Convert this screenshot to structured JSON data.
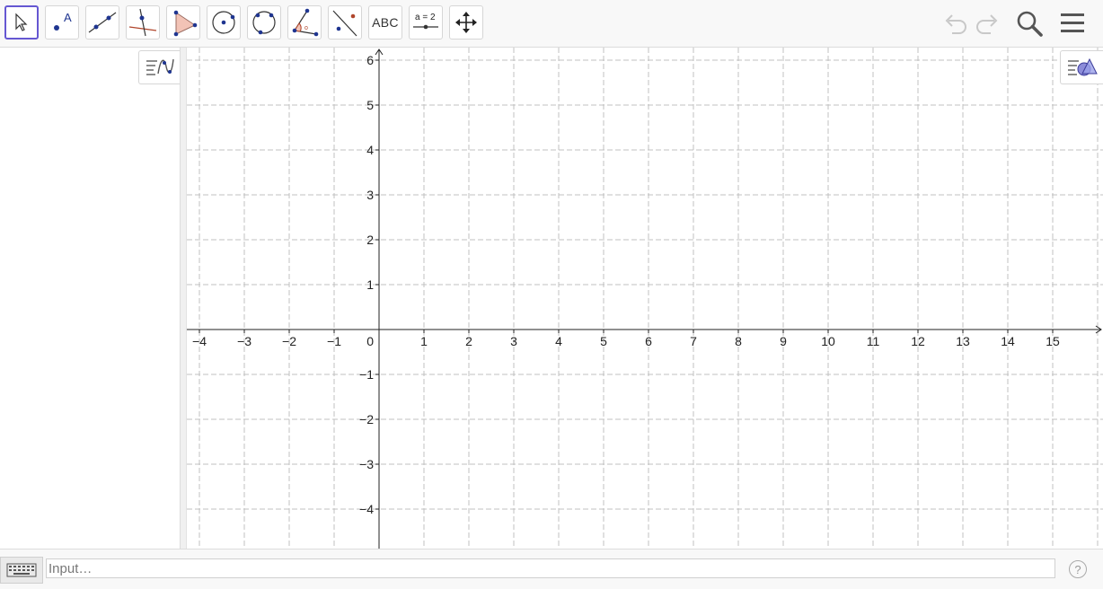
{
  "toolbar": {
    "tools": [
      {
        "name": "move-tool",
        "icon": "cursor-arrow-icon"
      },
      {
        "name": "point-tool",
        "icon": "point-icon"
      },
      {
        "name": "line-tool",
        "icon": "line-through-two-points-icon"
      },
      {
        "name": "perpendicular-line-tool",
        "icon": "perpendicular-line-icon"
      },
      {
        "name": "polygon-tool",
        "icon": "polygon-icon"
      },
      {
        "name": "circle-tool",
        "icon": "circle-center-point-icon"
      },
      {
        "name": "circle-three-points-tool",
        "icon": "circle-three-points-icon"
      },
      {
        "name": "angle-tool",
        "icon": "angle-icon"
      },
      {
        "name": "reflect-tool",
        "icon": "reflect-about-line-icon"
      },
      {
        "name": "text-tool",
        "label": "ABC"
      },
      {
        "name": "slider-tool",
        "label": "a = 2"
      },
      {
        "name": "move-graphics-view-tool",
        "icon": "move-view-arrows-icon"
      }
    ],
    "selected_tool": "move-tool",
    "accent_color": "#6557d2"
  },
  "graphics": {
    "x_ticks": [
      "−4",
      "−3",
      "−2",
      "−1",
      "1",
      "2",
      "3",
      "4",
      "5",
      "6",
      "7",
      "8",
      "9",
      "10",
      "11",
      "12",
      "13",
      "14",
      "15"
    ],
    "y_ticks_positive": [
      "1",
      "2",
      "3",
      "4",
      "5",
      "6"
    ],
    "y_ticks_negative": [
      "−1",
      "−2",
      "−3",
      "−4"
    ],
    "origin_label": "0",
    "x_range": [
      -4.3,
      16.0
    ],
    "y_range": [
      -4.8,
      6.3
    ],
    "grid": "dashed",
    "grid_color": "#c0c0c0"
  },
  "input_bar": {
    "placeholder": "Input…",
    "help_label": "?"
  }
}
